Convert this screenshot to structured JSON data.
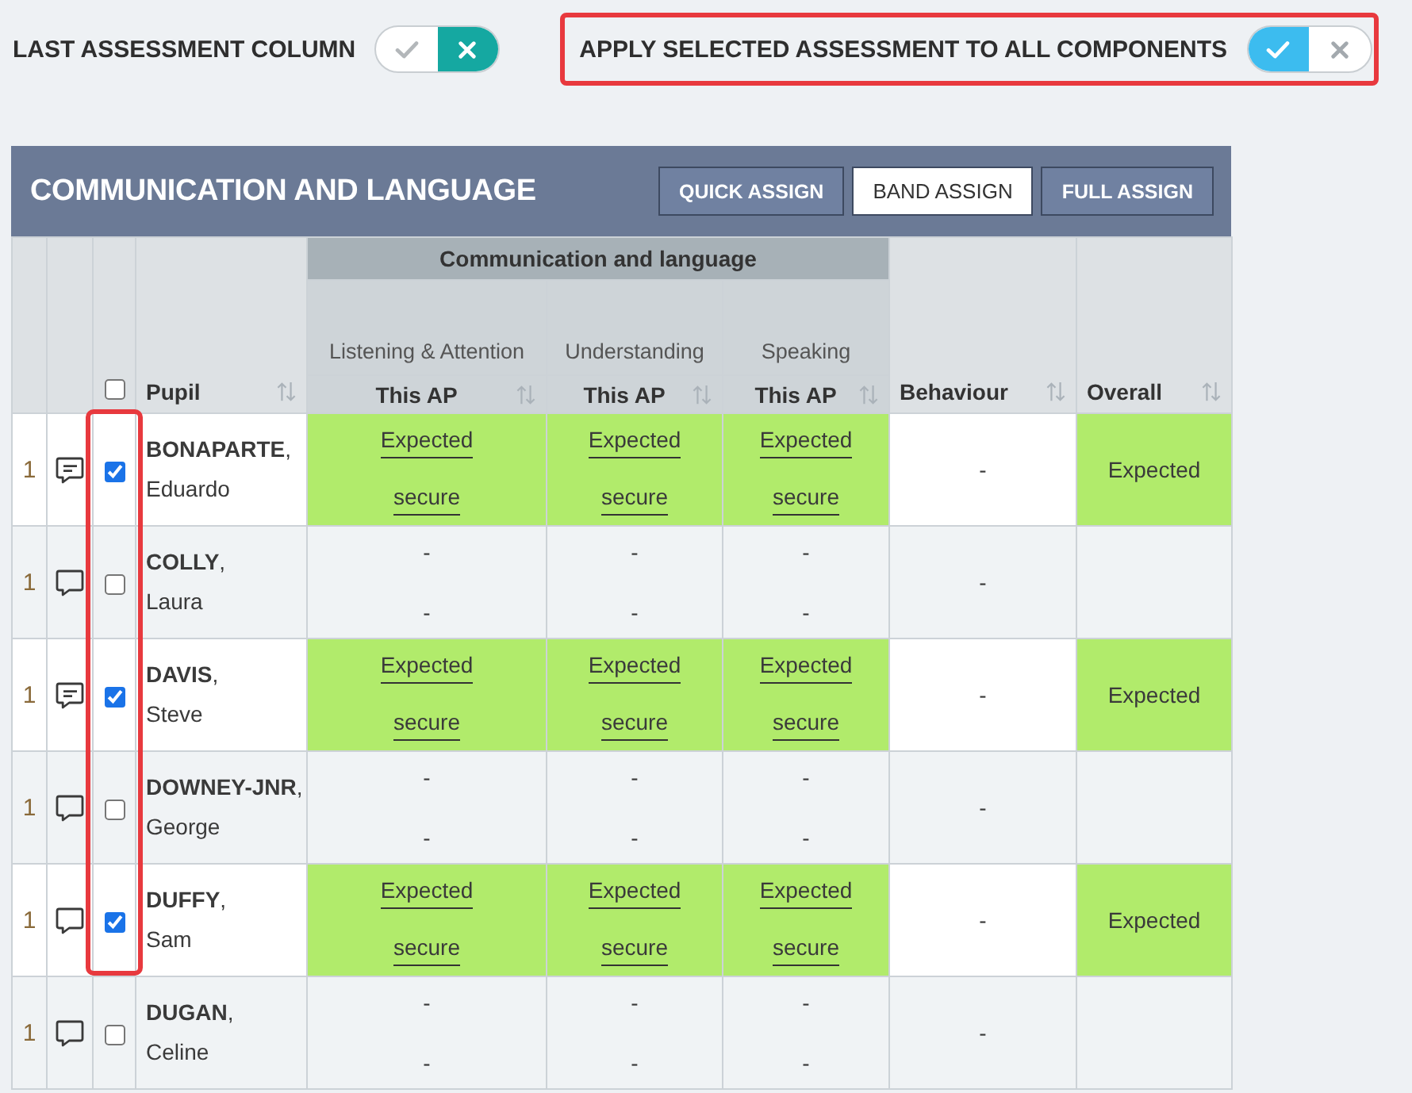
{
  "options": [
    {
      "label": "LAST ASSESSMENT COLUMN",
      "on": false,
      "highlighted": false
    },
    {
      "label": "APPLY SELECTED ASSESSMENT TO ALL COMPONENTS",
      "on": true,
      "highlighted": true
    }
  ],
  "panel": {
    "title": "COMMUNICATION AND LANGUAGE",
    "buttons": [
      {
        "label": "QUICK ASSIGN",
        "selected": false
      },
      {
        "label": "BAND ASSIGN",
        "selected": true
      },
      {
        "label": "FULL ASSIGN",
        "selected": false
      }
    ]
  },
  "table": {
    "select_all_checked": false,
    "pupil_header": "Pupil",
    "group_header": "Communication and language",
    "components": [
      {
        "label": "Listening & Attention",
        "subheader": "This AP"
      },
      {
        "label": "Understanding",
        "subheader": "This AP"
      },
      {
        "label": "Speaking",
        "subheader": "This AP"
      }
    ],
    "behaviour_header": "Behaviour",
    "overall_header": "Overall",
    "rows": [
      {
        "number": "1",
        "has_comment": true,
        "checked": true,
        "highlighted": true,
        "surname": "**BONAPARTE**,",
        "forename": "Eduardo",
        "assessments": [
          {
            "kind": "recorded",
            "color": "#b1eb6b",
            "grade": "Expected",
            "step": "secure"
          },
          {
            "kind": "recorded",
            "color": "#b1eb6b",
            "grade": "Expected",
            "step": "secure"
          },
          {
            "kind": "recorded",
            "color": "#b1eb6b",
            "grade": "Expected",
            "step": "secure"
          }
        ],
        "behaviour": "-",
        "overall": {
          "text": "Expected",
          "color": "#b1eb6b"
        }
      },
      {
        "number": "1",
        "has_comment": false,
        "checked": false,
        "highlighted": true,
        "surname": "**COLLY**,",
        "forename": "Laura",
        "assessments": [
          {
            "kind": "blank",
            "grade": "-",
            "step": "-"
          },
          {
            "kind": "blank",
            "grade": "-",
            "step": "-"
          },
          {
            "kind": "blank",
            "grade": "-",
            "step": "-"
          }
        ],
        "behaviour": "-"
      },
      {
        "number": "1",
        "has_comment": true,
        "checked": true,
        "highlighted": true,
        "surname": "**DAVIS**,",
        "forename": "Steve",
        "assessments": [
          {
            "kind": "recorded",
            "color": "#b1eb6b",
            "grade": "Expected",
            "step": "secure"
          },
          {
            "kind": "recorded",
            "color": "#b1eb6b",
            "grade": "Expected",
            "step": "secure"
          },
          {
            "kind": "recorded",
            "color": "#b1eb6b",
            "grade": "Expected",
            "step": "secure"
          }
        ],
        "behaviour": "-",
        "overall": {
          "text": "Expected",
          "color": "#b1eb6b"
        }
      },
      {
        "number": "1",
        "has_comment": false,
        "checked": false,
        "highlighted": true,
        "surname": "**DOWNEY-JNR**,",
        "forename": "George",
        "assessments": [
          {
            "kind": "blank",
            "grade": "-",
            "step": "-"
          },
          {
            "kind": "blank",
            "grade": "-",
            "step": "-"
          },
          {
            "kind": "blank",
            "grade": "-",
            "step": "-"
          }
        ],
        "behaviour": "-"
      },
      {
        "number": "1",
        "has_comment": false,
        "checked": true,
        "highlighted": true,
        "surname": "**DUFFY**,",
        "forename": "Sam",
        "assessments": [
          {
            "kind": "recorded",
            "color": "#b1eb6b",
            "grade": "Expected",
            "step": "secure"
          },
          {
            "kind": "recorded",
            "color": "#b1eb6b",
            "grade": "Expected",
            "step": "secure"
          },
          {
            "kind": "recorded",
            "color": "#b1eb6b",
            "grade": "Expected",
            "step": "secure"
          }
        ],
        "behaviour": "-",
        "overall": {
          "text": "Expected",
          "color": "#b1eb6b"
        }
      },
      {
        "number": "1",
        "has_comment": false,
        "checked": false,
        "highlighted": false,
        "surname": "**DUGAN**,",
        "forename": "Celine",
        "assessments": [
          {
            "kind": "blank",
            "grade": "-",
            "step": "-"
          },
          {
            "kind": "blank",
            "grade": "-",
            "step": "-"
          },
          {
            "kind": "blank",
            "grade": "-",
            "step": "-"
          }
        ],
        "behaviour": "-"
      }
    ]
  }
}
